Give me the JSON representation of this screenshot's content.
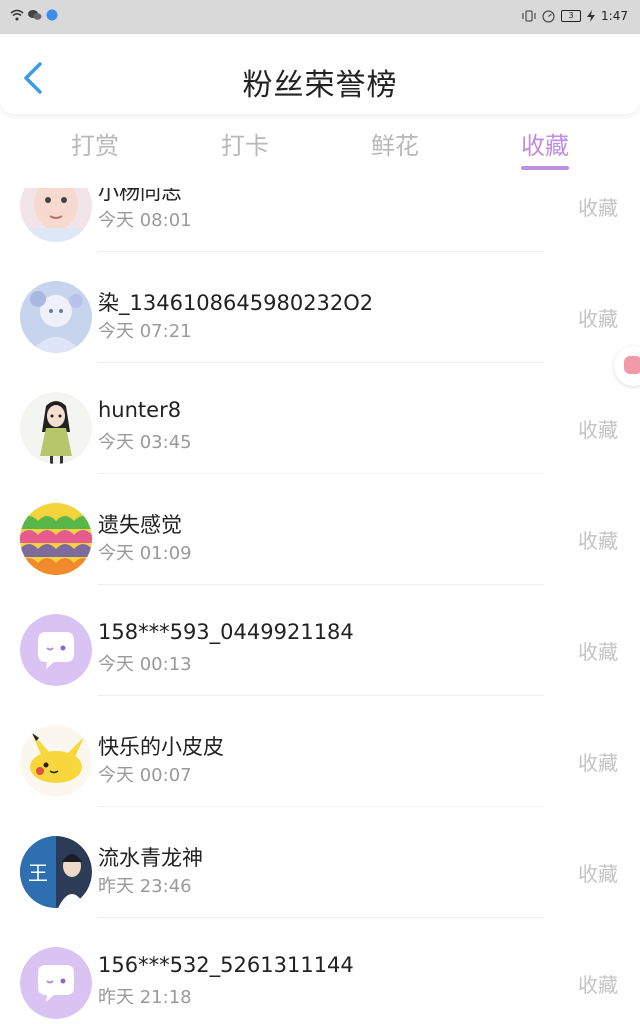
{
  "status_bar": {
    "time": "1:47",
    "battery": "3",
    "icons": [
      "wifi-icon",
      "wechat-icon",
      "app-icon",
      "vibrate-icon",
      "speed-icon",
      "battery-icon",
      "charging-icon"
    ]
  },
  "header": {
    "title": "粉丝荣誉榜",
    "back_icon": "chevron-left-icon"
  },
  "tabs": [
    {
      "label": "打赏",
      "active": false
    },
    {
      "label": "打卡",
      "active": false
    },
    {
      "label": "鲜花",
      "active": false
    },
    {
      "label": "收藏",
      "active": true
    }
  ],
  "colors": {
    "accent": "#c08ee0",
    "inactive_tab": "#b8b8b8",
    "status_bar_bg": "#d9d9d9"
  },
  "list": {
    "rows": [
      {
        "name": "小杨同志",
        "time": "今天 08:01",
        "action": "收藏",
        "avatar": "photo-avatar"
      },
      {
        "name": "染_1346108645980232O2",
        "time": "今天 07:21",
        "action": "收藏",
        "avatar": "anime-avatar"
      },
      {
        "name": "hunter8",
        "time": "今天 03:45",
        "action": "收藏",
        "avatar": "anime-girl-avatar"
      },
      {
        "name": "遗失感觉",
        "time": "今天 01:09",
        "action": "收藏",
        "avatar": "pattern-avatar"
      },
      {
        "name": "158***593_0449921184",
        "time": "今天 00:13",
        "action": "收藏",
        "avatar": "default-chat-avatar"
      },
      {
        "name": "快乐的小皮皮",
        "time": "今天 00:07",
        "action": "收藏",
        "avatar": "pikachu-avatar"
      },
      {
        "name": "流水青龙神",
        "time": "昨天 23:46",
        "action": "收藏",
        "avatar": "character-avatar"
      },
      {
        "name": "156***532_5261311144",
        "time": "昨天 21:18",
        "action": "收藏",
        "avatar": "default-chat-avatar"
      }
    ]
  },
  "avatar_text": {
    "character": "王"
  }
}
